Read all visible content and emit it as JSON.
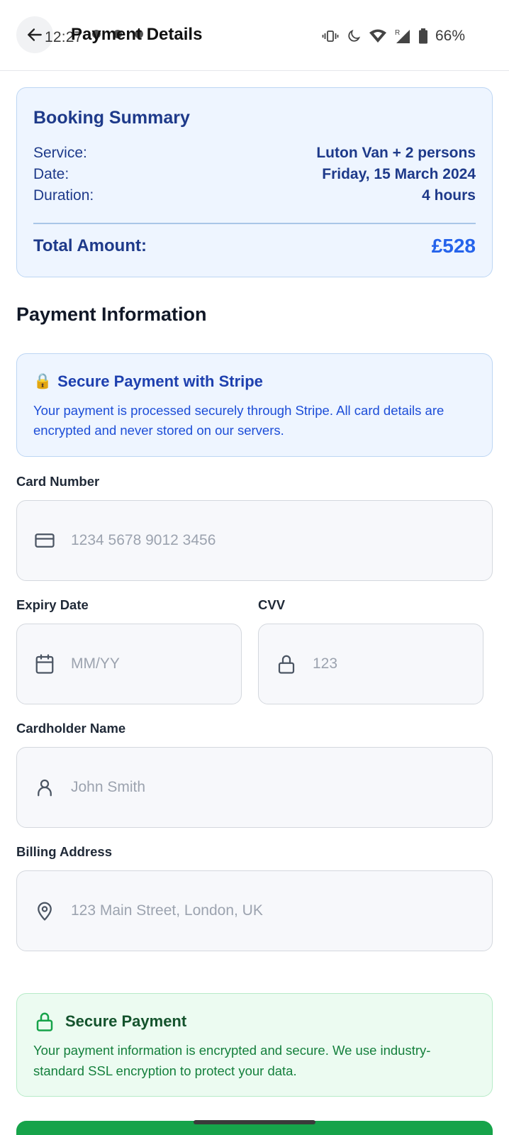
{
  "status_bar": {
    "time": "12:27",
    "battery": "66%"
  },
  "header": {
    "title": "Payment Details"
  },
  "booking_summary": {
    "title": "Booking Summary",
    "rows": [
      {
        "label": "Service:",
        "value": "Luton Van + 2 persons"
      },
      {
        "label": "Date:",
        "value": "Friday, 15 March 2024"
      },
      {
        "label": "Duration:",
        "value": "4 hours"
      }
    ],
    "total_label": "Total Amount:",
    "total_value": "£528"
  },
  "payment_section": {
    "title": "Payment Information"
  },
  "stripe_notice": {
    "icon": "🔒",
    "title": "Secure Payment with Stripe",
    "text": "Your payment is processed securely through Stripe. All card details are encrypted and never stored on our servers."
  },
  "form": {
    "card_number": {
      "label": "Card Number",
      "placeholder": "1234 5678 9012 3456",
      "icon": "credit-card-icon"
    },
    "expiry": {
      "label": "Expiry Date",
      "placeholder": "MM/YY",
      "icon": "calendar-icon"
    },
    "cvv": {
      "label": "CVV",
      "placeholder": "123",
      "icon": "lock-icon"
    },
    "cardholder": {
      "label": "Cardholder Name",
      "placeholder": "John Smith",
      "icon": "user-icon"
    },
    "billing": {
      "label": "Billing Address",
      "placeholder": "123 Main Street, London, UK",
      "icon": "map-pin-icon"
    }
  },
  "secure_notice": {
    "title": "Secure Payment",
    "text": "Your payment information is encrypted and secure. We use industry-standard SSL encryption to protect your data."
  },
  "colors": {
    "primary_blue": "#1e3a8a",
    "accent_blue": "#2563eb",
    "success_green": "#16a34a"
  }
}
